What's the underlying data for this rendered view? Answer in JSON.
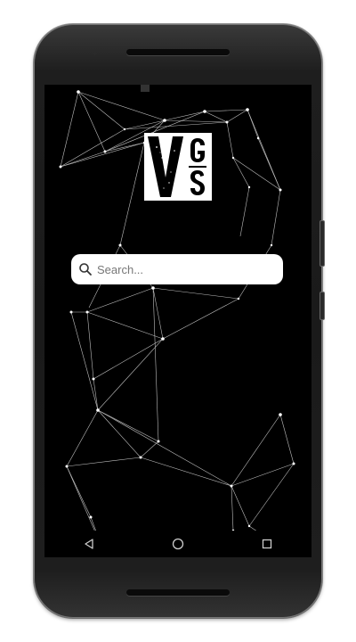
{
  "app": {
    "logo_text": "VGS"
  },
  "search": {
    "placeholder": "Search...",
    "value": ""
  },
  "navigation": {
    "buttons": [
      {
        "icon": "back-icon"
      },
      {
        "icon": "home-icon"
      },
      {
        "icon": "recents-icon"
      }
    ]
  },
  "colors": {
    "screen_background": "#000000",
    "network_lines": "#ffffff",
    "search_background": "#ffffff"
  }
}
